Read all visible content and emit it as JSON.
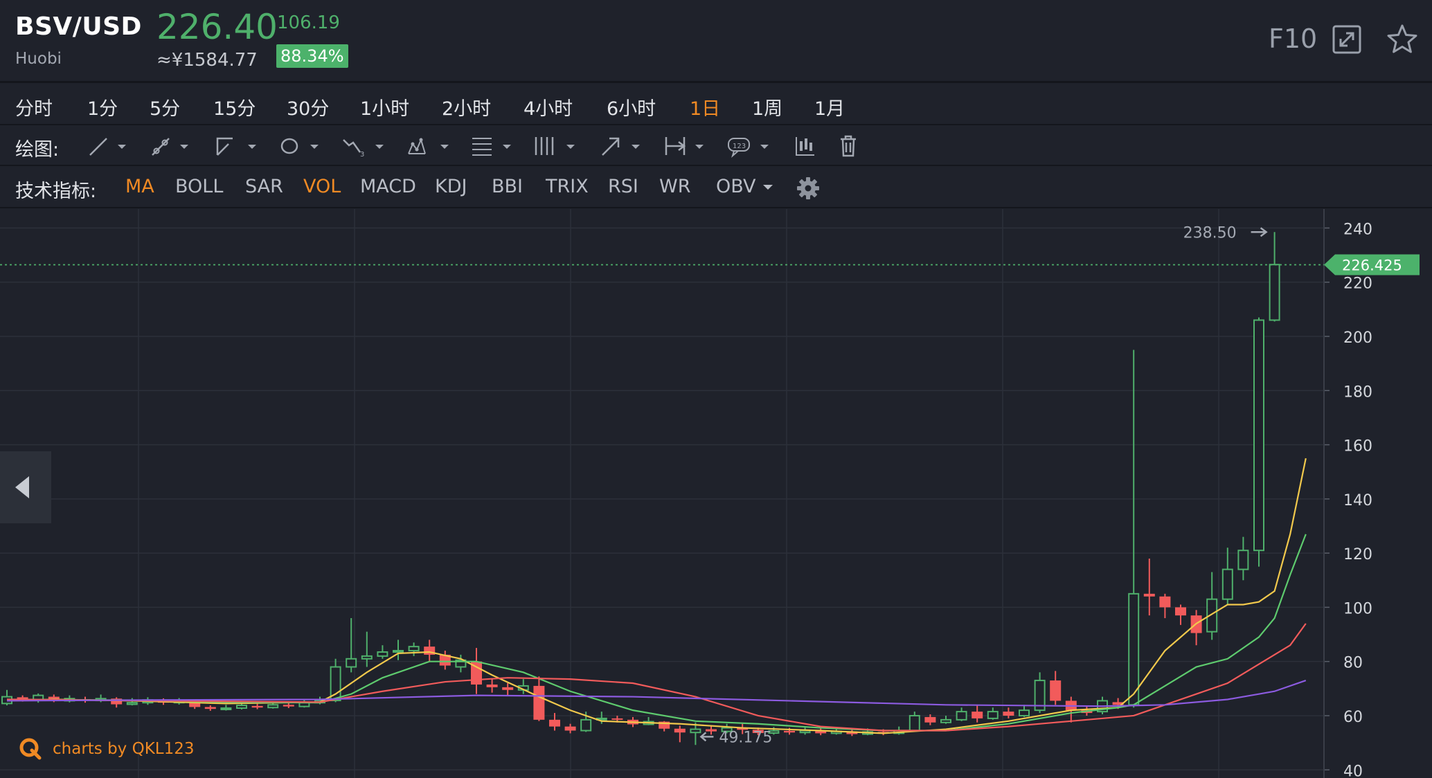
{
  "header": {
    "pair": "BSV/USD",
    "exchange": "Huobi",
    "price": "226.40",
    "price_cny": "≈¥1584.77",
    "change": "106.19",
    "change_pct": "88.34%",
    "f10_label": "F10",
    "colors": {
      "up": "#4fb06b",
      "down": "#f25b5b",
      "accent": "#f08a24"
    }
  },
  "timeframes": [
    {
      "label": "分时",
      "active": false
    },
    {
      "label": "1分",
      "active": false
    },
    {
      "label": "5分",
      "active": false
    },
    {
      "label": "15分",
      "active": false
    },
    {
      "label": "30分",
      "active": false
    },
    {
      "label": "1小时",
      "active": false
    },
    {
      "label": "2小时",
      "active": false
    },
    {
      "label": "4小时",
      "active": false
    },
    {
      "label": "6小时",
      "active": false
    },
    {
      "label": "1日",
      "active": true
    },
    {
      "label": "1周",
      "active": false
    },
    {
      "label": "1月",
      "active": false
    }
  ],
  "drawing": {
    "label": "绘图:",
    "tools": [
      "line-tool-icon",
      "segment-tool-icon",
      "polyline-tool-icon",
      "ellipse-tool-icon",
      "wave-tool-icon",
      "pattern-tool-icon",
      "fib-tool-icon",
      "parallel-lines-icon",
      "arrow-tool-icon",
      "range-tool-icon",
      "label-tool-icon",
      "candlestick-tool-icon",
      "trash-icon"
    ]
  },
  "indicators": {
    "label": "技术指标:",
    "items": [
      {
        "label": "MA",
        "active": true
      },
      {
        "label": "BOLL",
        "active": false
      },
      {
        "label": "SAR",
        "active": false
      },
      {
        "label": "VOL",
        "active": true
      },
      {
        "label": "MACD",
        "active": false
      },
      {
        "label": "KDJ",
        "active": false
      },
      {
        "label": "BBI",
        "active": false
      },
      {
        "label": "TRIX",
        "active": false
      },
      {
        "label": "RSI",
        "active": false
      },
      {
        "label": "WR",
        "active": false
      },
      {
        "label": "OBV",
        "active": false,
        "dropdown": true
      }
    ]
  },
  "brand": "charts by QKL123",
  "chart_data": {
    "type": "candlestick",
    "y_ticks": [
      40,
      60,
      80,
      100,
      120,
      140,
      160,
      180,
      200,
      220,
      240
    ],
    "ylim": [
      37,
      247
    ],
    "current_price_label": "226.425",
    "current_price": 226.425,
    "high_label": "238.50",
    "high": 238.5,
    "low_label": "49.175",
    "low": 49.175,
    "candles": [
      [
        64.5,
        67.0,
        69.5,
        63.8
      ],
      [
        66.8,
        65.8,
        67.5,
        65.2
      ],
      [
        65.8,
        67.5,
        68.2,
        64.8
      ],
      [
        67.0,
        65.5,
        67.8,
        65.0
      ],
      [
        65.5,
        66.3,
        67.5,
        64.9
      ],
      [
        66.1,
        65.6,
        67.0,
        64.8
      ],
      [
        65.6,
        66.3,
        67.8,
        65.0
      ],
      [
        66.3,
        64.2,
        66.8,
        63.0
      ],
      [
        64.2,
        64.8,
        66.5,
        63.8
      ],
      [
        64.8,
        65.8,
        66.8,
        64.0
      ],
      [
        65.8,
        64.8,
        66.4,
        64.0
      ],
      [
        64.8,
        65.5,
        66.5,
        64.1
      ],
      [
        65.4,
        63.2,
        66.0,
        62.5
      ],
      [
        63.2,
        62.5,
        63.8,
        61.8
      ],
      [
        62.5,
        62.8,
        64.0,
        61.9
      ],
      [
        62.8,
        63.8,
        64.6,
        62.3
      ],
      [
        63.6,
        63.0,
        64.4,
        62.4
      ],
      [
        63.0,
        64.0,
        64.6,
        62.6
      ],
      [
        64.0,
        63.4,
        64.8,
        62.8
      ],
      [
        63.4,
        64.8,
        66.0,
        63.0
      ],
      [
        64.8,
        65.6,
        67.0,
        64.2
      ],
      [
        65.6,
        78.0,
        81.0,
        65.0
      ],
      [
        78.0,
        81.0,
        96.0,
        76.0
      ],
      [
        81.0,
        82.0,
        91.0,
        78.0
      ],
      [
        82.0,
        83.5,
        86.0,
        81.0
      ],
      [
        83.5,
        84.0,
        88.0,
        80.5
      ],
      [
        84.0,
        85.5,
        87.0,
        82.0
      ],
      [
        85.5,
        82.5,
        88.0,
        80.0
      ],
      [
        82.5,
        78.5,
        84.0,
        77.0
      ],
      [
        78.0,
        80.5,
        82.5,
        76.0
      ],
      [
        80.0,
        71.5,
        85.0,
        68.0
      ],
      [
        71.5,
        70.5,
        73.5,
        68.5
      ],
      [
        70.5,
        69.5,
        72.0,
        67.5
      ],
      [
        69.5,
        71.0,
        73.5,
        68.0
      ],
      [
        71.0,
        58.5,
        74.5,
        58.0
      ],
      [
        58.5,
        56.0,
        61.0,
        54.5
      ],
      [
        56.0,
        54.5,
        57.0,
        53.5
      ],
      [
        54.5,
        58.5,
        61.5,
        54.0
      ],
      [
        58.5,
        59.0,
        61.5,
        57.0
      ],
      [
        59.0,
        58.5,
        60.0,
        57.5
      ],
      [
        58.5,
        56.8,
        59.5,
        55.8
      ],
      [
        56.8,
        57.8,
        59.5,
        56.5
      ],
      [
        57.8,
        55.2,
        58.0,
        54.2
      ],
      [
        55.2,
        53.8,
        56.3,
        50.2
      ],
      [
        53.8,
        55.0,
        57.5,
        49.2
      ],
      [
        55.0,
        54.2,
        56.4,
        53.0
      ],
      [
        54.2,
        55.5,
        57.0,
        53.5
      ],
      [
        55.5,
        54.8,
        57.0,
        53.2
      ],
      [
        54.8,
        53.6,
        55.6,
        52.8
      ],
      [
        53.6,
        54.4,
        55.8,
        53.0
      ],
      [
        54.4,
        53.8,
        55.5,
        53.0
      ],
      [
        53.8,
        54.5,
        55.6,
        53.0
      ],
      [
        54.5,
        53.5,
        55.5,
        52.8
      ],
      [
        53.5,
        54.2,
        55.8,
        53.0
      ],
      [
        54.2,
        53.2,
        55.0,
        52.5
      ],
      [
        53.2,
        54.0,
        55.3,
        52.8
      ],
      [
        54.0,
        53.5,
        55.0,
        52.8
      ],
      [
        53.5,
        54.5,
        56.0,
        53.0
      ],
      [
        54.5,
        60.0,
        61.5,
        54.0
      ],
      [
        59.5,
        57.5,
        60.5,
        56.5
      ],
      [
        57.5,
        58.5,
        60.0,
        57.0
      ],
      [
        58.5,
        61.5,
        63.0,
        58.0
      ],
      [
        61.5,
        59.0,
        64.0,
        57.5
      ],
      [
        59.0,
        61.5,
        63.0,
        58.5
      ],
      [
        61.5,
        60.0,
        63.0,
        59.0
      ],
      [
        60.0,
        62.0,
        64.0,
        59.5
      ],
      [
        62.0,
        73.0,
        76.0,
        61.0
      ],
      [
        73.0,
        65.5,
        76.5,
        64.0
      ],
      [
        65.5,
        62.0,
        67.0,
        57.5
      ],
      [
        62.0,
        61.0,
        63.5,
        60.0
      ],
      [
        61.5,
        65.5,
        67.0,
        60.5
      ],
      [
        65.0,
        64.0,
        66.5,
        62.5
      ],
      [
        64.0,
        105.0,
        195.0,
        63.0
      ],
      [
        105.0,
        104.0,
        118.0,
        97.0
      ],
      [
        104.0,
        100.0,
        105.0,
        96.0
      ],
      [
        100.0,
        97.0,
        101.0,
        93.5
      ],
      [
        97.0,
        90.5,
        99.0,
        86.0
      ],
      [
        91.0,
        103.0,
        113.0,
        88.0
      ],
      [
        103.0,
        114.0,
        122.0,
        101.0
      ],
      [
        114.0,
        121.0,
        126.0,
        110.0
      ],
      [
        121.0,
        206.0,
        207.0,
        115.0
      ],
      [
        206.0,
        226.5,
        238.5,
        205.5
      ]
    ],
    "ma_lines": [
      {
        "name": "",
        "color": "#f2c94c",
        "points": [
          [
            0,
            65.5
          ],
          [
            3,
            66
          ],
          [
            8,
            65.5
          ],
          [
            14,
            64.5
          ],
          [
            20,
            65
          ],
          [
            21,
            68
          ],
          [
            23,
            76
          ],
          [
            25,
            83
          ],
          [
            27,
            83.5
          ],
          [
            29,
            81
          ],
          [
            31,
            75
          ],
          [
            34,
            67
          ],
          [
            36,
            62
          ],
          [
            38,
            58
          ],
          [
            43,
            57
          ],
          [
            47,
            55.5
          ],
          [
            52,
            54.5
          ],
          [
            56,
            53.5
          ],
          [
            60,
            55
          ],
          [
            64,
            58
          ],
          [
            68,
            62
          ],
          [
            71,
            63
          ],
          [
            72,
            68
          ],
          [
            74,
            84
          ],
          [
            76,
            94
          ],
          [
            78,
            101
          ],
          [
            79,
            101
          ],
          [
            80,
            102
          ],
          [
            81,
            106
          ],
          [
            82,
            127
          ],
          [
            83,
            155
          ]
        ]
      },
      {
        "name": "",
        "color": "#5ecb6e",
        "points": [
          [
            0,
            66
          ],
          [
            8,
            65.7
          ],
          [
            14,
            65
          ],
          [
            20,
            64.8
          ],
          [
            22,
            68
          ],
          [
            24,
            74
          ],
          [
            27,
            80
          ],
          [
            30,
            80
          ],
          [
            33,
            76
          ],
          [
            36,
            69
          ],
          [
            40,
            62
          ],
          [
            44,
            58
          ],
          [
            48,
            57
          ],
          [
            52,
            55.5
          ],
          [
            56,
            54.5
          ],
          [
            60,
            54.5
          ],
          [
            64,
            57
          ],
          [
            68,
            61
          ],
          [
            71,
            63
          ],
          [
            72,
            64
          ],
          [
            74,
            71
          ],
          [
            76,
            78
          ],
          [
            78,
            81
          ],
          [
            80,
            89
          ],
          [
            81,
            96
          ],
          [
            82,
            112
          ],
          [
            83,
            127
          ]
        ]
      },
      {
        "name": "",
        "color": "#f25b5b",
        "points": [
          [
            0,
            66
          ],
          [
            10,
            65.5
          ],
          [
            20,
            65
          ],
          [
            24,
            69
          ],
          [
            28,
            72.5
          ],
          [
            32,
            74
          ],
          [
            36,
            73.5
          ],
          [
            40,
            72
          ],
          [
            44,
            67
          ],
          [
            48,
            60
          ],
          [
            52,
            56
          ],
          [
            56,
            54.5
          ],
          [
            60,
            54.5
          ],
          [
            64,
            56
          ],
          [
            68,
            58
          ],
          [
            72,
            60
          ],
          [
            74,
            64
          ],
          [
            76,
            68
          ],
          [
            78,
            72
          ],
          [
            80,
            79
          ],
          [
            82,
            86
          ],
          [
            83,
            94
          ]
        ]
      },
      {
        "name": "",
        "color": "#8c5be0",
        "points": [
          [
            0,
            65.5
          ],
          [
            10,
            65.8
          ],
          [
            20,
            66
          ],
          [
            30,
            67.5
          ],
          [
            40,
            67
          ],
          [
            50,
            65.5
          ],
          [
            60,
            64
          ],
          [
            70,
            63.5
          ],
          [
            74,
            64
          ],
          [
            78,
            66
          ],
          [
            80,
            68
          ],
          [
            81,
            69
          ],
          [
            83,
            73
          ]
        ]
      }
    ]
  }
}
